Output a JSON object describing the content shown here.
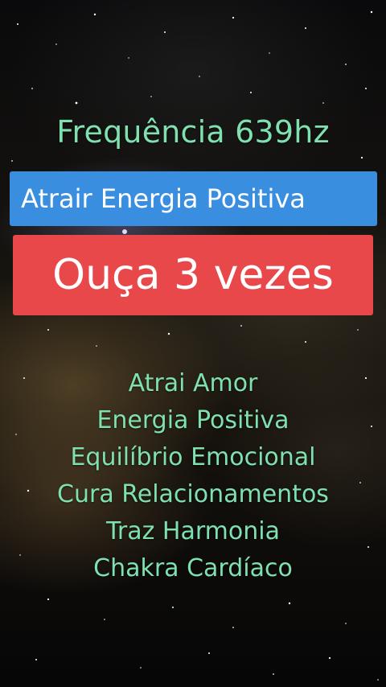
{
  "overlay": {
    "title": "Frequência 639hz",
    "banner_blue": "Atrair Energia Positiva",
    "banner_red": "Ouça 3 vezes"
  },
  "benefits": [
    "Atrai Amor",
    "Energia Positiva",
    "Equilíbrio Emocional",
    "Cura Relacionamentos",
    "Traz Harmonia",
    "Chakra Cardíaco"
  ],
  "colors": {
    "title_text": "#7fe0b0",
    "banner_blue": "#3a8ee0",
    "banner_red": "#e8484a",
    "banner_text": "#ffffff"
  }
}
